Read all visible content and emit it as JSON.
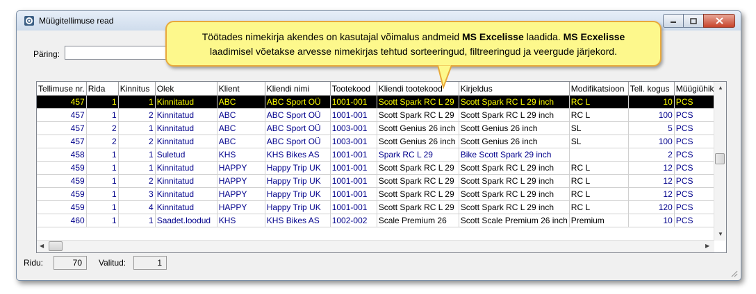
{
  "window": {
    "title": "Müügitellimuse read"
  },
  "query": {
    "label": "Päring:",
    "value": ""
  },
  "callout": {
    "part1": "Töötades nimekirja akendes on kasutajal võimalus andmeid ",
    "bold1": "MS Excelisse",
    "part2": " laadida. ",
    "bold2": "MS Ecxelisse",
    "line2": "laadimisel võetakse arvesse nimekirjas tehtud sorteeringud, filtreeringud ja veergude järjekord."
  },
  "table": {
    "headers": [
      "Tellimuse nr.",
      "Rida",
      "Kinnitus",
      "Olek",
      "Klient",
      "Kliendi nimi",
      "Tootekood",
      "Kliendi tootekood",
      "Kirjeldus",
      "Modifikatsioon",
      "Tell. kogus",
      "Müügiühik"
    ],
    "rows": [
      [
        "457",
        "1",
        "1",
        "Kinnitatud",
        "ABC",
        "ABC Sport OÜ",
        "1001-001",
        "Scott Spark RC L 29",
        "Scott Spark RC L 29 inch",
        "RC L",
        "10",
        "PCS"
      ],
      [
        "457",
        "1",
        "2",
        "Kinnitatud",
        "ABC",
        "ABC Sport OÜ",
        "1001-001",
        "Scott Spark RC L 29",
        "Scott Spark RC L 29 inch",
        "RC L",
        "100",
        "PCS"
      ],
      [
        "457",
        "2",
        "1",
        "Kinnitatud",
        "ABC",
        "ABC Sport OÜ",
        "1003-001",
        "Scott Genius 26 inch",
        "Scott Genius 26 inch",
        "SL",
        "5",
        "PCS"
      ],
      [
        "457",
        "2",
        "2",
        "Kinnitatud",
        "ABC",
        "ABC Sport OÜ",
        "1003-001",
        "Scott Genius 26 inch",
        "Scott Genius 26 inch",
        "SL",
        "100",
        "PCS"
      ],
      [
        "458",
        "1",
        "1",
        "Suletud",
        "KHS",
        "KHS Bikes AS",
        "1001-001",
        "Spark RC L 29",
        "Bike Scott Spark 29 inch",
        "",
        "2",
        "PCS"
      ],
      [
        "459",
        "1",
        "1",
        "Kinnitatud",
        "HAPPY",
        "Happy Trip UK",
        "1001-001",
        "Scott Spark RC L 29",
        "Scott Spark RC L 29 inch",
        "RC L",
        "12",
        "PCS"
      ],
      [
        "459",
        "1",
        "2",
        "Kinnitatud",
        "HAPPY",
        "Happy Trip UK",
        "1001-001",
        "Scott Spark RC L 29",
        "Scott Spark RC L 29 inch",
        "RC L",
        "12",
        "PCS"
      ],
      [
        "459",
        "1",
        "3",
        "Kinnitatud",
        "HAPPY",
        "Happy Trip UK",
        "1001-001",
        "Scott Spark RC L 29",
        "Scott Spark RC L 29 inch",
        "RC L",
        "12",
        "PCS"
      ],
      [
        "459",
        "1",
        "4",
        "Kinnitatud",
        "HAPPY",
        "Happy Trip UK",
        "1001-001",
        "Scott Spark RC L 29",
        "Scott Spark RC L 29 inch",
        "RC L",
        "120",
        "PCS"
      ],
      [
        "460",
        "1",
        "1",
        "Saadet.loodud",
        "KHS",
        "KHS Bikes AS",
        "1002-002",
        "Scale Premium 26",
        "Scott Scale Premium 26 inch",
        "Premium",
        "10",
        "PCS"
      ]
    ]
  },
  "status": {
    "rows_label": "Ridu:",
    "rows_value": "70",
    "selected_label": "Valitud:",
    "selected_value": "1"
  },
  "colors": {
    "selected_bg": "#000000",
    "selected_fg": "#ffff00",
    "data_fg": "#00008b",
    "callout_bg": "#fdf88c"
  }
}
